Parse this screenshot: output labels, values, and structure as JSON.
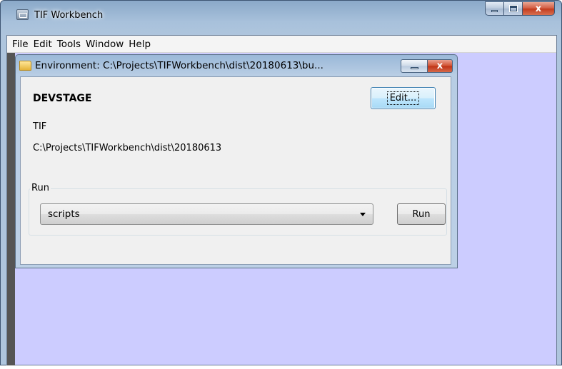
{
  "app": {
    "title": "TIF Workbench",
    "caption_minimize": "–",
    "caption_close": "x"
  },
  "menubar": {
    "items": [
      "File",
      "Edit",
      "Tools",
      "Window",
      "Help"
    ]
  },
  "environment_window": {
    "title": "Environment: C:\\Projects\\TIFWorkbench\\dist\\20180613\\bu...",
    "name": "DEVSTAGE",
    "type": "TIF",
    "path": "C:\\Projects\\TIFWorkbench\\dist\\20180613",
    "edit_label": "Edit...",
    "close_glyph": "x",
    "run_group": {
      "legend": "Run",
      "selected_script": "scripts",
      "run_label": "Run"
    }
  },
  "colors": {
    "desktop": "#ccccff",
    "dialog_bg": "#f0f0f0",
    "close_red": "#c23a1d"
  }
}
